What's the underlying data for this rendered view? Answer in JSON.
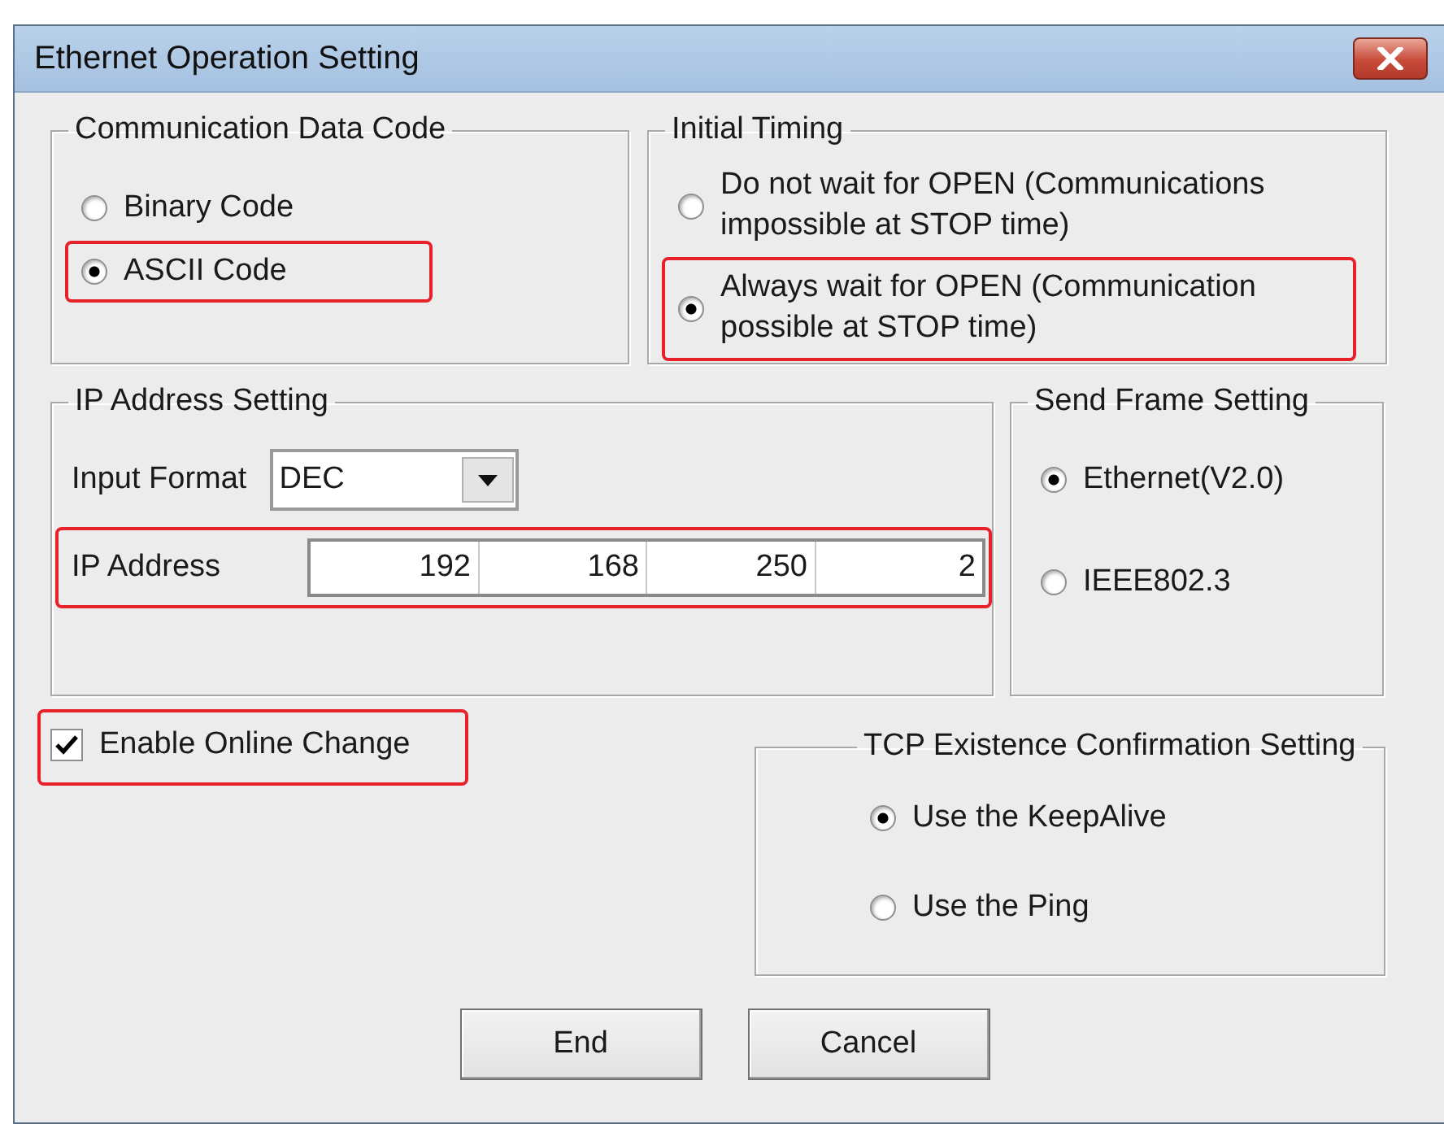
{
  "window": {
    "title": "Ethernet Operation Setting"
  },
  "communication_data_code": {
    "title": "Communication Data Code",
    "options": [
      {
        "label": "Binary Code",
        "selected": false,
        "highlighted": false
      },
      {
        "label": "ASCII Code",
        "selected": true,
        "highlighted": true
      }
    ]
  },
  "initial_timing": {
    "title": "Initial Timing",
    "options": [
      {
        "label": "Do not wait for OPEN (Communications impossible at STOP time)",
        "selected": false,
        "highlighted": false
      },
      {
        "label": "Always wait for OPEN (Communication possible at STOP time)",
        "selected": true,
        "highlighted": true
      }
    ]
  },
  "ip_address_setting": {
    "title": "IP Address Setting",
    "input_format": {
      "label": "Input Format",
      "value": "DEC"
    },
    "ip_address": {
      "label": "IP Address",
      "octets": [
        "192",
        "168",
        "250",
        "2"
      ],
      "highlighted": true
    }
  },
  "send_frame_setting": {
    "title": "Send Frame Setting",
    "options": [
      {
        "label": "Ethernet(V2.0)",
        "selected": true,
        "highlighted": false
      },
      {
        "label": "IEEE802.3",
        "selected": false,
        "highlighted": false
      }
    ]
  },
  "enable_online_change": {
    "label": "Enable Online Change",
    "checked": true,
    "highlighted": true
  },
  "tcp_existence_confirmation_setting": {
    "title": "TCP Existence Confirmation Setting",
    "options": [
      {
        "label": "Use the KeepAlive",
        "selected": true,
        "highlighted": false
      },
      {
        "label": "Use the Ping",
        "selected": false,
        "highlighted": false
      }
    ]
  },
  "buttons": [
    "End",
    "Cancel"
  ]
}
